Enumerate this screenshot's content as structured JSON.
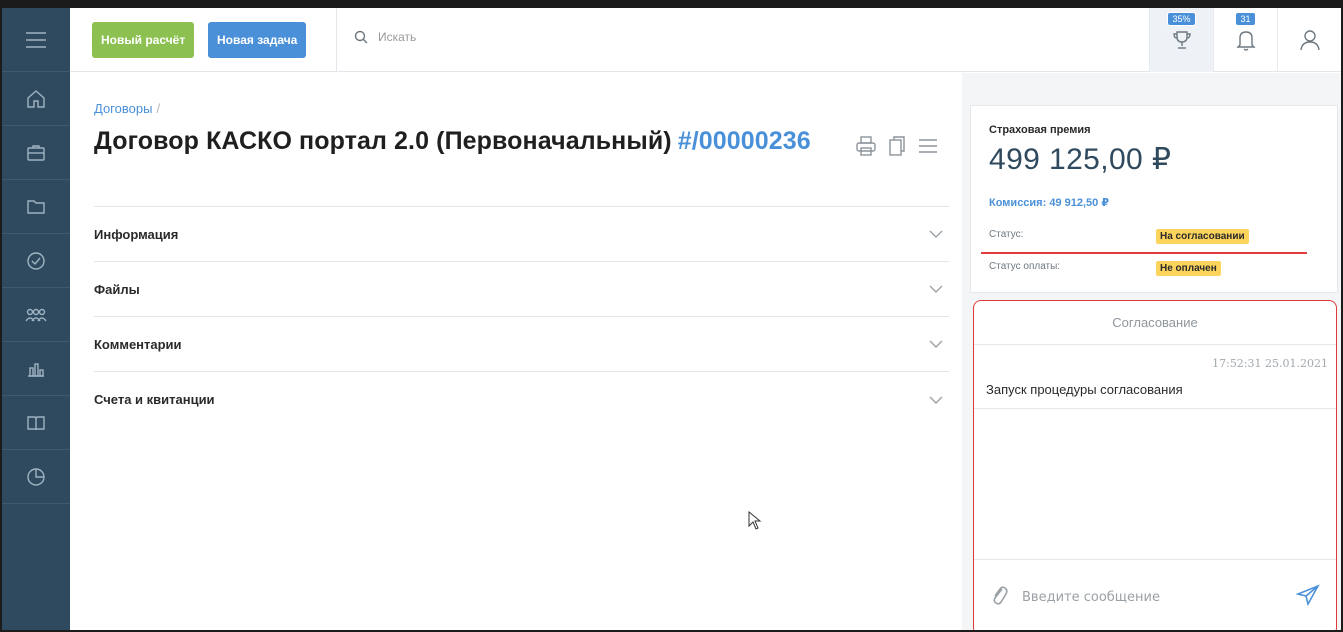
{
  "toolbar": {
    "new_calc_label": "Новый расчёт",
    "new_task_label": "Новая задача",
    "search_placeholder": "Искать"
  },
  "badges": {
    "achievement": "35%",
    "notifications": "31"
  },
  "breadcrumb": {
    "parent": "Договоры",
    "separator": "/"
  },
  "contract": {
    "title": "Договор КАСКО портал 2.0 (Первоначальный)",
    "number": "#/00000236"
  },
  "sections": [
    {
      "label": "Информация"
    },
    {
      "label": "Файлы"
    },
    {
      "label": "Комментарии"
    },
    {
      "label": "Счета и квитанции"
    }
  ],
  "premium": {
    "label": "Страховая премия",
    "value": "499 125,00 ₽",
    "commission": "Комиссия: 49 912,50 ₽"
  },
  "status": {
    "label": "Статус:",
    "value": "На согласовании",
    "payment_label": "Статус оплаты:",
    "payment_value": "Не оплачен",
    "highlight_color": "#fcd45c"
  },
  "approval": {
    "title": "Согласование",
    "message_time": "17:52:31 25.01.2021",
    "message_text": "Запуск процедуры согласования",
    "input_placeholder": "Введите сообщение"
  },
  "colors": {
    "sidebar": "#2f4a5e",
    "accent_blue": "#4a90d9",
    "accent_green": "#8cc152",
    "alert_red": "#e23b3b"
  }
}
